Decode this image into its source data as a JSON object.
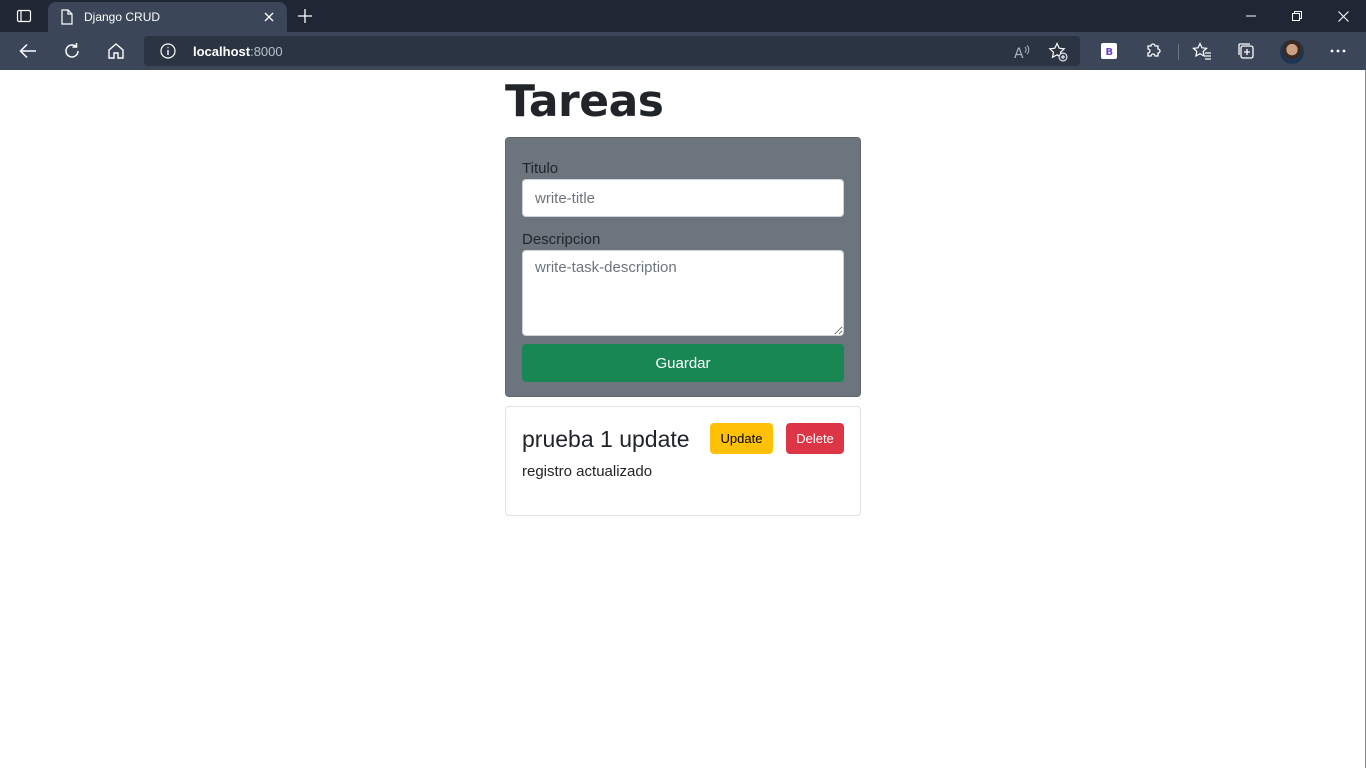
{
  "browser": {
    "tab_title": "Django CRUD",
    "url_host": "localhost",
    "url_port": ":8000"
  },
  "icons": {
    "tab_toggle": "tab-actions-icon",
    "page": "page-icon",
    "close": "close-icon",
    "new_tab": "plus-icon",
    "back": "back-arrow-icon",
    "refresh": "refresh-icon",
    "home": "home-icon",
    "info": "info-icon",
    "read_aloud": "read-aloud-icon",
    "add_favorite": "add-favorite-icon",
    "extension_b": "bootstrap-extension-icon",
    "extensions": "puzzle-icon",
    "favorites": "favorites-icon",
    "collections": "collections-icon",
    "more": "more-icon"
  },
  "colors": {
    "form_bg": "#6c757d",
    "save": "#198754",
    "update": "#ffc107",
    "delete": "#dc3545"
  },
  "page": {
    "heading": "Tareas",
    "form": {
      "title_label": "Titulo",
      "title_placeholder": "write-title",
      "description_label": "Descripcion",
      "description_placeholder": "write-task-description",
      "save_label": "Guardar"
    },
    "tasks": [
      {
        "title": "prueba 1 update",
        "description": "registro actualizado",
        "update_label": "Update",
        "delete_label": "Delete"
      }
    ]
  }
}
